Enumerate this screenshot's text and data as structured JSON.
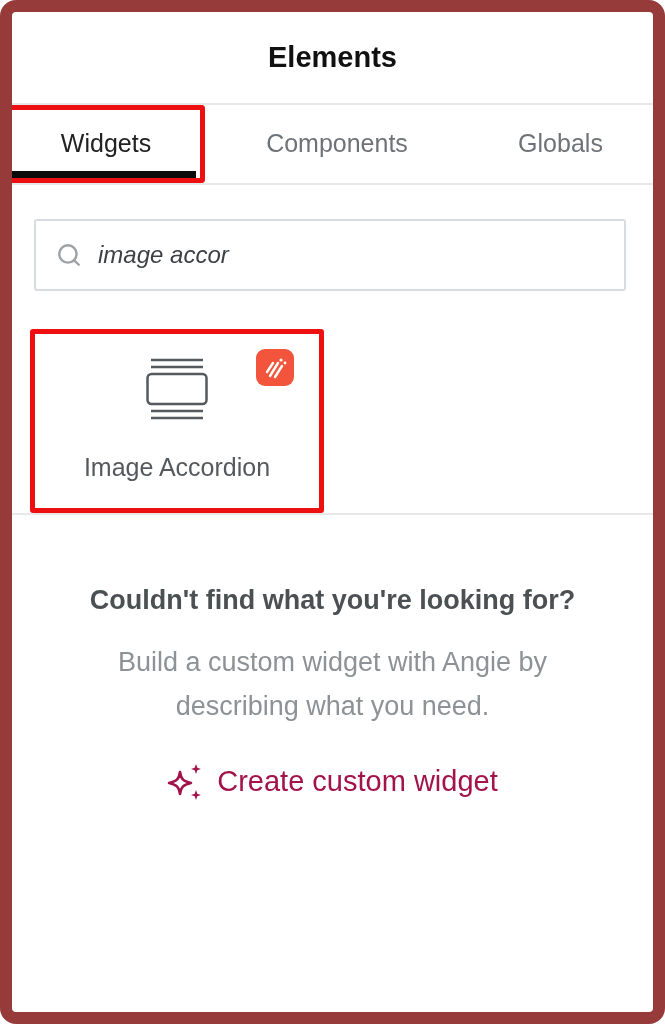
{
  "panel": {
    "title": "Elements"
  },
  "tabs": [
    {
      "label": "Widgets",
      "selected": true,
      "highlighted": true
    },
    {
      "label": "Components",
      "selected": false,
      "highlighted": false
    },
    {
      "label": "Globals",
      "selected": false,
      "highlighted": false
    }
  ],
  "search": {
    "value": "image accor"
  },
  "widgets": [
    {
      "label": "Image Accordion",
      "highlighted": true,
      "pro": true
    }
  ],
  "empty_state": {
    "heading": "Couldn't find what you're looking for?",
    "text": "Build a custom widget with Angie by describing what you need.",
    "action": "Create custom widget"
  }
}
